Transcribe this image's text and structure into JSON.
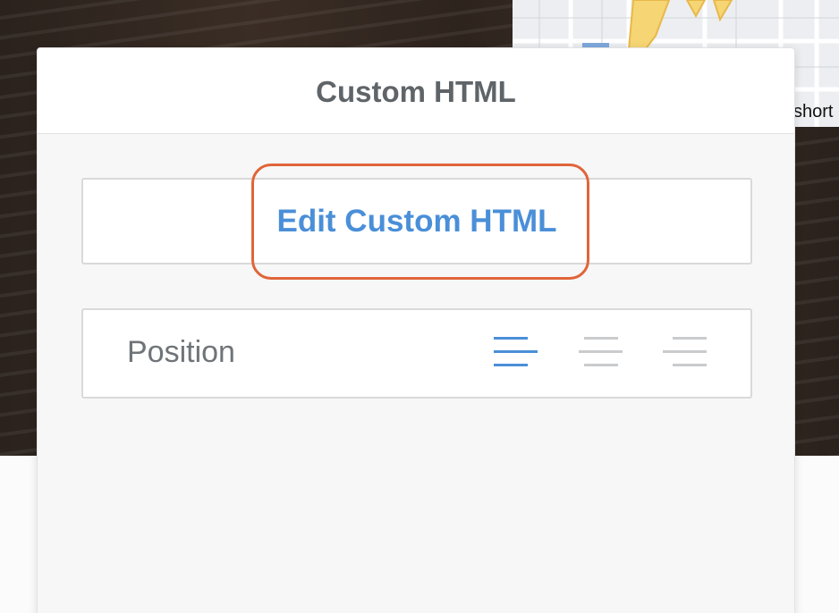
{
  "panel": {
    "title": "Custom HTML",
    "edit_button_label": "Edit Custom HTML",
    "position_label": "Position",
    "alignment_options": [
      {
        "name": "align-left",
        "selected": true
      },
      {
        "name": "align-center",
        "selected": false
      },
      {
        "name": "align-right",
        "selected": false
      }
    ]
  },
  "background": {
    "map_label": "short"
  },
  "colors": {
    "accent": "#4a8fd8",
    "highlight": "#e0653a",
    "inactive_icon": "#c9cbcd",
    "title_text": "#5f6468"
  }
}
